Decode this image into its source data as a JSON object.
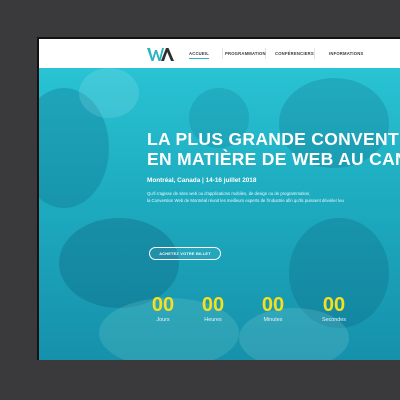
{
  "nav": {
    "links": [
      "ACCUEIL",
      "PROGRAMMATION",
      "CONFÉRENCIERS",
      "INFORMATIONS"
    ]
  },
  "hero": {
    "title_line1": "LA PLUS GRANDE CONVENTI",
    "title_line2": "EN MATIÈRE DE WEB AU CAN",
    "subtitle": "Montréal, Canada | 14-16 juillet 2018",
    "desc_line1": "Qu'il s'agisse de sites web ou d'applications mobiles, de design ou de programmation,",
    "desc_line2": "la Convention Web de Montréal réunit les meilleurs experts de l'industrie afin qu'ils puissent dévoiler leu",
    "cta_label": "ACHETEZ VOTRE BILLET"
  },
  "countdown": [
    {
      "value": "00",
      "label": "Jours"
    },
    {
      "value": "00",
      "label": "Heures"
    },
    {
      "value": "00",
      "label": "Minutes"
    },
    {
      "value": "00",
      "label": "Secondes"
    }
  ],
  "colors": {
    "accent": "#2bb5c3",
    "countdown": "#f4e01e",
    "logo_dark": "#2f2f2f"
  }
}
